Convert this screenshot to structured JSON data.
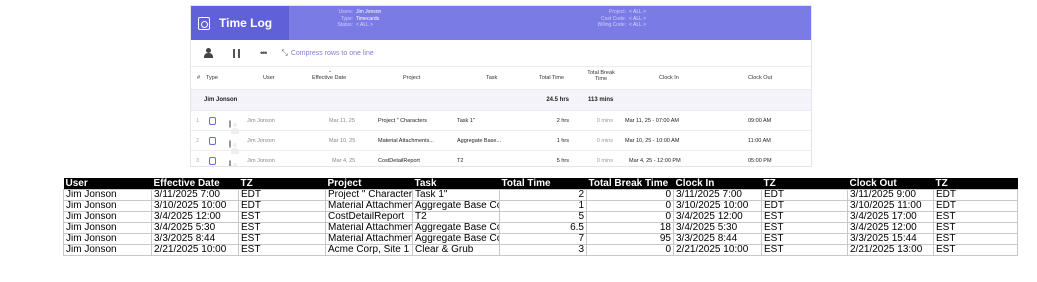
{
  "app": {
    "title": "Time Log",
    "filters_left": [
      {
        "label": "Users:",
        "value": "Jim Jonson"
      },
      {
        "label": "Type:",
        "value": "Timecards"
      },
      {
        "label": "Status:",
        "value": "< ALL >"
      }
    ],
    "filters_right": [
      {
        "label": "Project:",
        "value": "< ALL >"
      },
      {
        "label": "Cost Code:",
        "value": "< ALL >"
      },
      {
        "label": "Billing Code:",
        "value": "< ALL >"
      }
    ],
    "toolbar": {
      "more": "•••",
      "compress_label": "Compress rows to one line"
    },
    "columns": {
      "num": "#",
      "type": "Type",
      "user": "User",
      "effective_date": "Effective Date",
      "project": "Project",
      "task": "Task",
      "total_time": "Total Time",
      "total_break": "Total Break Time",
      "clock_in": "Clock In",
      "clock_out": "Clock Out"
    },
    "group": {
      "name": "Jim Jonson",
      "total_time": "24.5 hrs",
      "total_break": "113 mins"
    },
    "rows": [
      {
        "num": "1",
        "user": "Jim Jonson",
        "date": "Mar 11, 25",
        "project": "Project \" Characters",
        "task": "Task 1\"",
        "total": "2 hrs",
        "break": "0 mins",
        "clock_in": "Mar 11, 25 - 07:00 AM",
        "clock_out": "09:00 AM"
      },
      {
        "num": "2",
        "user": "Jim Jonson",
        "date": "Mar 10, 25",
        "project": "Material Attachments...",
        "task": "Aggregate Base...",
        "total": "1 hrs",
        "break": "0 mins",
        "clock_in": "Mar 10, 25 - 10:00 AM",
        "clock_out": "11:00 AM"
      },
      {
        "num": "3",
        "user": "Jim Jonson",
        "date": "Mar 4, 25",
        "project": "CostDetailReport",
        "task": "T2",
        "total": "5 hrs",
        "break": "0 mins",
        "clock_in": "Mar 4, 25 - 12:00 PM",
        "clock_out": "05:00 PM"
      }
    ]
  },
  "sheet": {
    "headers": [
      "User",
      "Effective Date",
      "TZ",
      "Project",
      "Task",
      "Total Time",
      "Total Break Time",
      "Clock In",
      "TZ",
      "Clock Out",
      "TZ"
    ],
    "rows": [
      [
        "Jim Jonson",
        "3/11/2025 7:00",
        "EDT",
        "Project \" Characters",
        "Task 1\"",
        "2",
        "0",
        "3/11/2025 7:00",
        "EDT",
        "3/11/2025 9:00",
        "EDT"
      ],
      [
        "Jim Jonson",
        "3/10/2025 10:00",
        "EDT",
        "Material Attachments",
        "Aggregate Base Cou",
        "1",
        "0",
        "3/10/2025 10:00",
        "EDT",
        "3/10/2025 11:00",
        "EDT"
      ],
      [
        "Jim Jonson",
        "3/4/2025 12:00",
        "EST",
        "CostDetailReport",
        "T2",
        "5",
        "0",
        "3/4/2025 12:00",
        "EST",
        "3/4/2025 17:00",
        "EST"
      ],
      [
        "Jim Jonson",
        "3/4/2025 5:30",
        "EST",
        "Material Attachments",
        "Aggregate Base Cou",
        "6.5",
        "18",
        "3/4/2025 5:30",
        "EST",
        "3/4/2025 12:00",
        "EST"
      ],
      [
        "Jim Jonson",
        "3/3/2025 8:44",
        "EST",
        "Material Attachments",
        "Aggregate Base Cou",
        "7",
        "95",
        "3/3/2025 8:44",
        "EST",
        "3/3/2025 15:44",
        "EST"
      ],
      [
        "Jim Jonson",
        "2/21/2025 10:00",
        "EST",
        "Acme Corp, Site 1",
        "Clear & Grub",
        "3",
        "0",
        "2/21/2025 10:00",
        "EST",
        "2/21/2025 13:00",
        "EST"
      ]
    ]
  }
}
